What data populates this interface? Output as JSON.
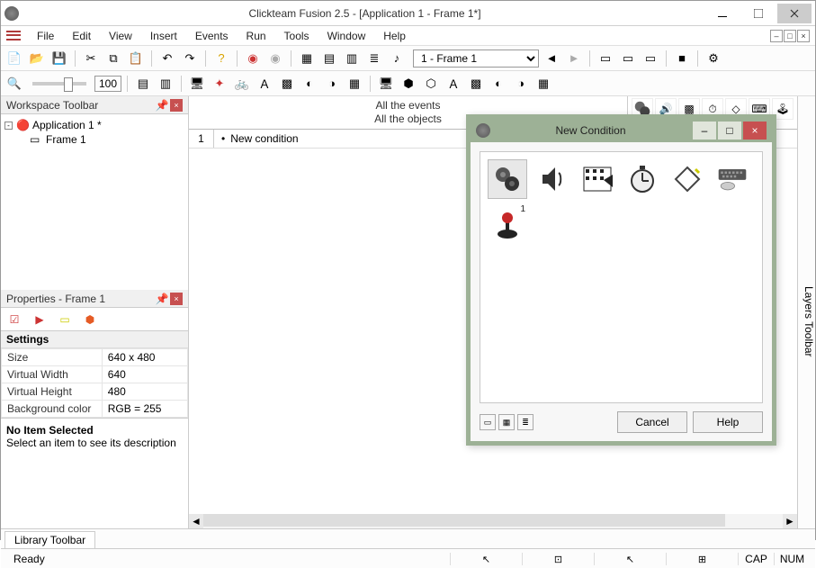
{
  "title": "Clickteam Fusion 2.5 - [Application 1 - Frame 1*]",
  "menus": [
    "File",
    "Edit",
    "View",
    "Insert",
    "Events",
    "Run",
    "Tools",
    "Window",
    "Help"
  ],
  "frame_combo": "1 - Frame 1",
  "zoom": "100",
  "workspace": {
    "title": "Workspace Toolbar",
    "app": "Application 1 *",
    "frame": "Frame 1"
  },
  "properties": {
    "title": "Properties - Frame 1",
    "section": "Settings",
    "rows": [
      {
        "k": "Size",
        "v": "640 x 480"
      },
      {
        "k": "Virtual Width",
        "v": "640"
      },
      {
        "k": "Virtual Height",
        "v": "480"
      },
      {
        "k": "Background color",
        "v": "RGB = 255"
      }
    ],
    "noitem_t": "No Item Selected",
    "noitem_d": "Select an item to see its description"
  },
  "events": {
    "hdr1": "All the events",
    "hdr2": "All the objects",
    "row_num": "1",
    "row_cond": "New condition"
  },
  "layers_title": "Layers Toolbar",
  "library_title": "Library Toolbar",
  "status": {
    "ready": "Ready",
    "cap": "CAP",
    "num": "NUM"
  },
  "dialog": {
    "title": "New Condition",
    "cancel": "Cancel",
    "help": "Help",
    "player_badge": "1"
  }
}
